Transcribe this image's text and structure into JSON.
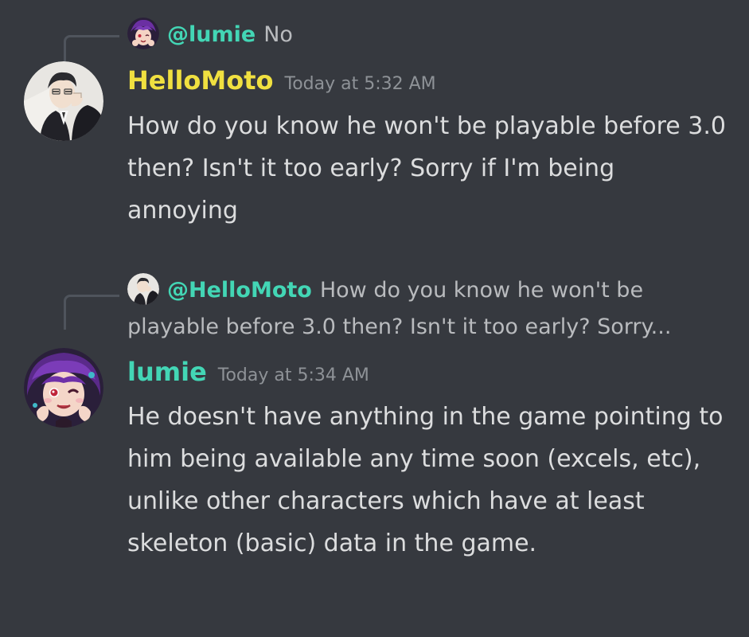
{
  "messages": [
    {
      "reply": {
        "author": "@lumie",
        "text": "No"
      },
      "author": "HelloMoto",
      "timestamp": "Today at 5:32 AM",
      "content": "How do you know he won't be playable before 3.0 then? Isn't it too early? Sorry if I'm being annoying",
      "avatar_icon": "avatar-icon"
    },
    {
      "reply": {
        "author": "@HelloMoto",
        "text": "How do you know he won't be playable before 3.0 then? Isn't it too early? Sorry..."
      },
      "author": "lumie",
      "timestamp": "Today at 5:34 AM",
      "content": "He doesn't have anything in the game pointing to him being available any time soon (excels, etc), unlike other characters which have at least skeleton (basic) data in the game.",
      "avatar_icon": "avatar-icon"
    }
  ],
  "colors": {
    "background": "#36393f",
    "hellomoto_name": "#f0e040",
    "lumie_name": "#43d6b5",
    "timestamp": "#8e9297",
    "text": "#dcddde",
    "reply_text": "#b9bbbe"
  }
}
